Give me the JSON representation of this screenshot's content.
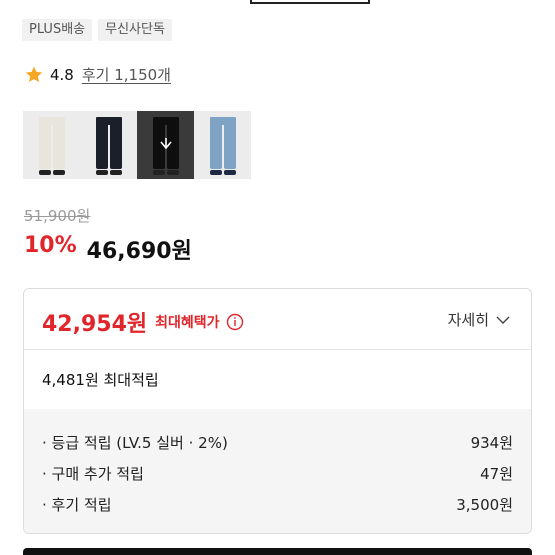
{
  "badges": [
    "PLUS배송",
    "무신사단독"
  ],
  "rating": {
    "value": "4.8",
    "reviews_link": "후기 1,150개"
  },
  "thumbnails": [
    {
      "color": "#e8e5dd",
      "shoe": "#222"
    },
    {
      "color": "#1b1f2a",
      "shoe": "#222"
    },
    {
      "color": "#0e0e0e",
      "shoe": "#222",
      "selected": true
    },
    {
      "color": "#7fa3c4",
      "shoe": "#1e2a44"
    }
  ],
  "price": {
    "original": "51,900원",
    "discount_percent": "10%",
    "sale": "46,690원"
  },
  "benefit": {
    "max_price": "42,954원",
    "max_label": "최대혜택가",
    "detail_label": "자세히",
    "points_total": "4,481원 최대적립",
    "points": [
      {
        "label": "· 등급 적립 (LV.5 실버 · 2%)",
        "value": "934원"
      },
      {
        "label": "· 구매 추가 적립",
        "value": "47원"
      },
      {
        "label": "· 후기 적립",
        "value": "3,500원"
      }
    ]
  },
  "colors": {
    "accent_red": "#e0262b",
    "star": "#f5a623"
  }
}
